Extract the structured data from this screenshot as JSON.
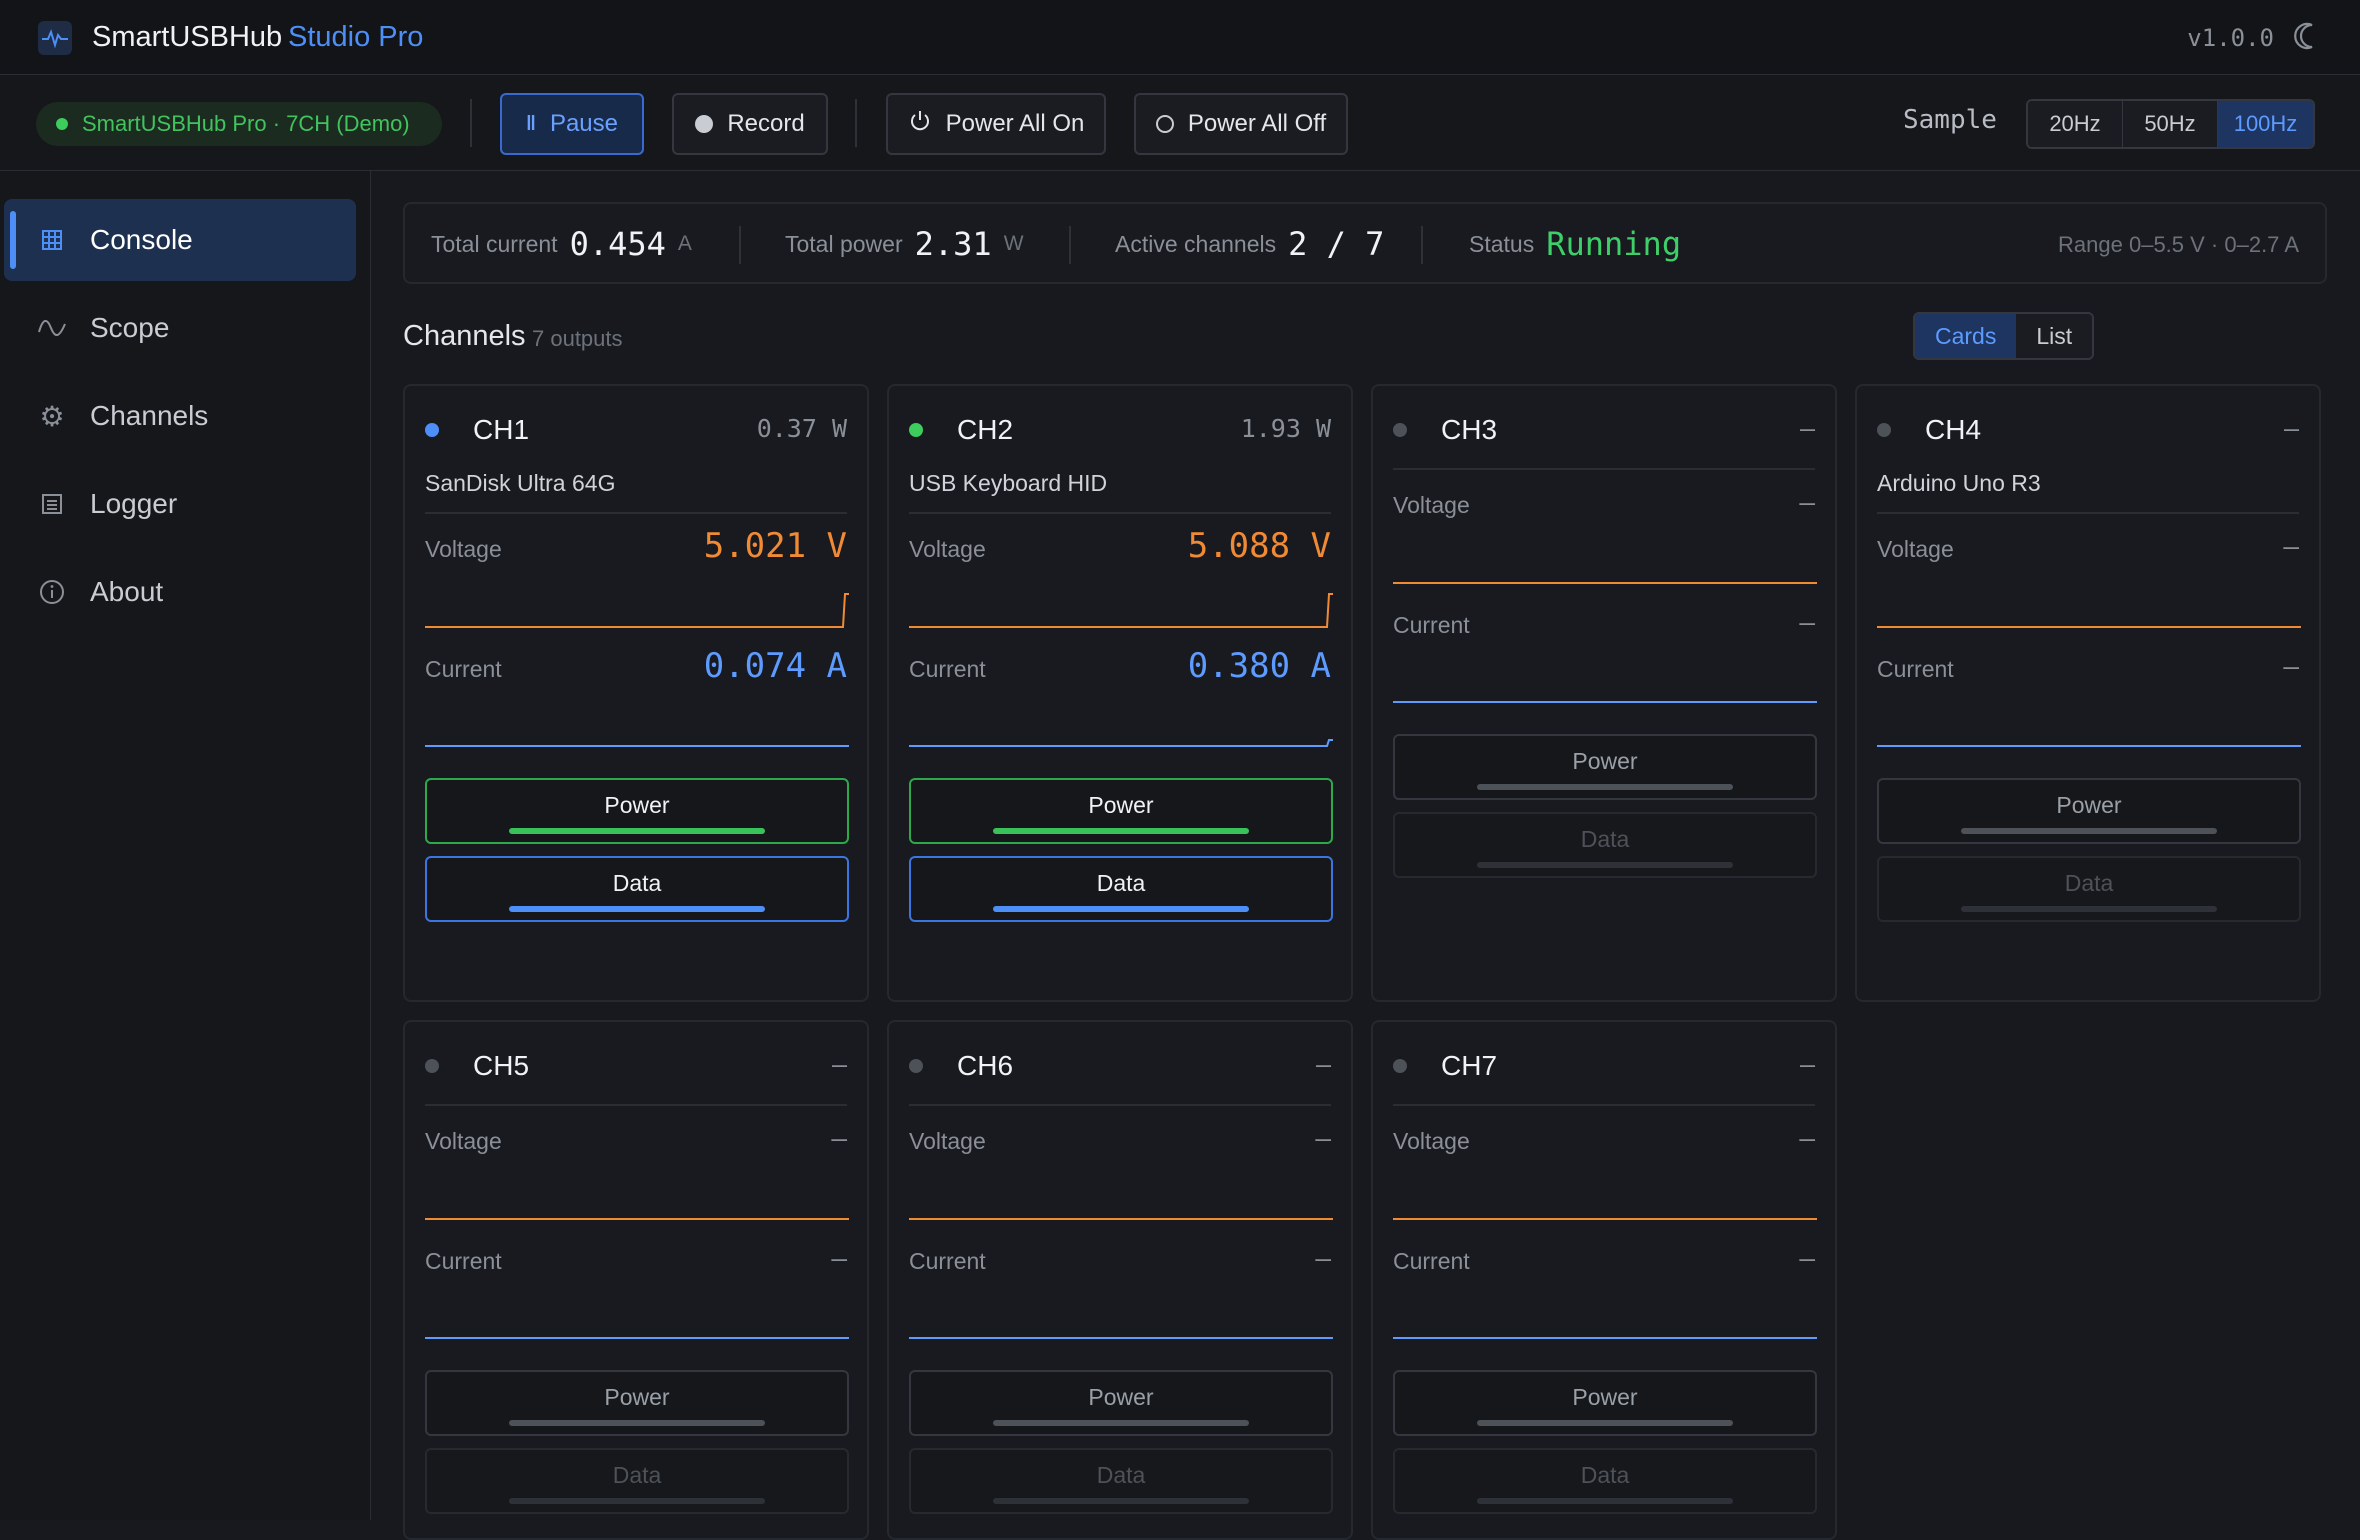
{
  "app": {
    "name": "SmartUSBHub",
    "edition": "Studio Pro",
    "version": "v1.0.0"
  },
  "toolbar": {
    "device": "SmartUSBHub Pro · 7CH (Demo)",
    "pause": "Pause",
    "record": "Record",
    "power_all_on": "Power All On",
    "power_all_off": "Power All Off",
    "sample_label": "Sample",
    "rates": [
      "20Hz",
      "50Hz",
      "100Hz"
    ],
    "selected_rate": "100Hz"
  },
  "sidebar": {
    "items": [
      {
        "label": "Console",
        "icon": "grid-icon",
        "active": true
      },
      {
        "label": "Scope",
        "icon": "wave-icon",
        "active": false
      },
      {
        "label": "Channels",
        "icon": "gear-icon",
        "active": false
      },
      {
        "label": "Logger",
        "icon": "list-icon",
        "active": false
      },
      {
        "label": "About",
        "icon": "info-icon",
        "active": false
      }
    ]
  },
  "summary": {
    "total_current_label": "Total current",
    "total_current": "0.454",
    "total_current_unit": "A",
    "total_power_label": "Total power",
    "total_power": "2.31",
    "total_power_unit": "W",
    "active_label": "Active channels",
    "active": "2 / 7",
    "status_label": "Status",
    "status": "Running",
    "range": "Range 0–5.5 V · 0–2.7 A"
  },
  "channels": {
    "title": "Channels",
    "subtitle": "7 outputs",
    "views": [
      "Cards",
      "List"
    ],
    "selected_view": "Cards",
    "labels": {
      "voltage": "Voltage",
      "current": "Current",
      "power": "Power",
      "data": "Data"
    },
    "items": [
      {
        "name": "CH1",
        "power": "0.37 W",
        "device": "SanDisk Ultra 64G",
        "voltage": "5.021 V",
        "current": "0.074 A",
        "active": true,
        "dot": "blue"
      },
      {
        "name": "CH2",
        "power": "1.93 W",
        "device": "USB Keyboard HID",
        "voltage": "5.088 V",
        "current": "0.380 A",
        "active": true,
        "dot": "green"
      },
      {
        "name": "CH3",
        "power": "—",
        "device": "",
        "voltage": "—",
        "current": "—",
        "active": false
      },
      {
        "name": "CH4",
        "power": "—",
        "device": "Arduino Uno R3",
        "voltage": "—",
        "current": "—",
        "active": false
      },
      {
        "name": "CH5",
        "power": "—",
        "device": "",
        "voltage": "—",
        "current": "—",
        "active": false
      },
      {
        "name": "CH6",
        "power": "—",
        "device": "",
        "voltage": "—",
        "current": "—",
        "active": false
      },
      {
        "name": "CH7",
        "power": "—",
        "device": "",
        "voltage": "—",
        "current": "—",
        "active": false
      }
    ]
  },
  "colors": {
    "accent": "#4d8ef7",
    "ok": "#3fcf6a",
    "voltage": "#f08a34",
    "current": "#5d9bff"
  }
}
